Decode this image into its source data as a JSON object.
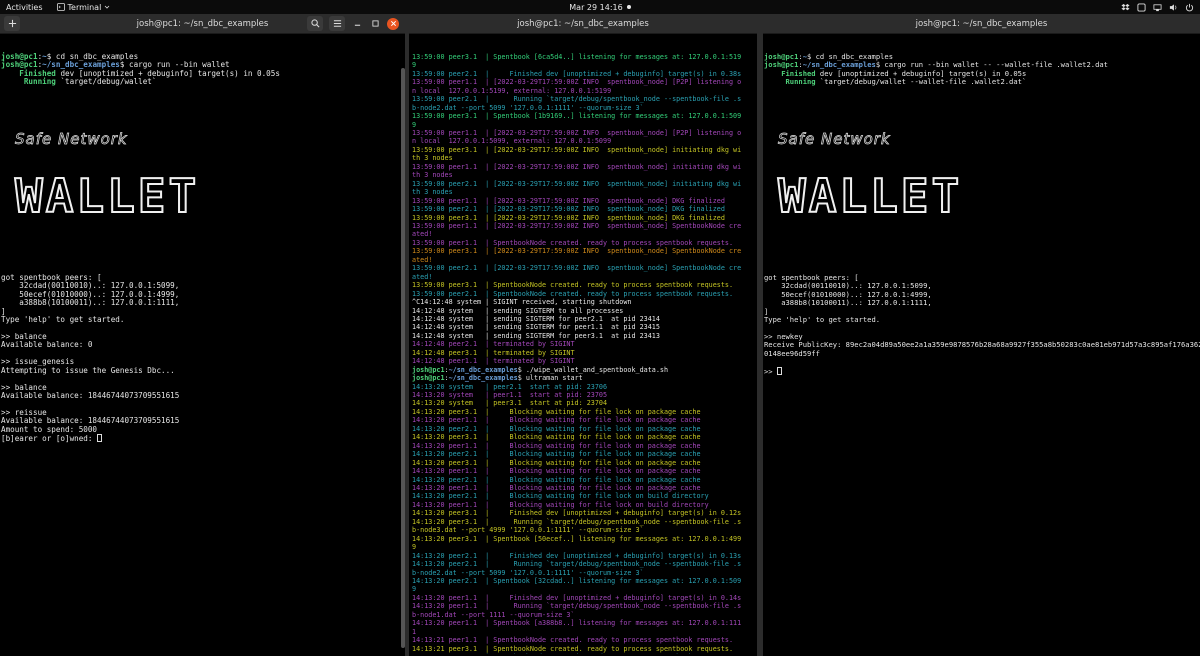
{
  "topbar": {
    "activities": "Activities",
    "app_menu": "Terminal",
    "clock": "Mar 29  14:16"
  },
  "windows": [
    {
      "title": "josh@pc1: ~/sn_dbc_examples"
    },
    {
      "title": "josh@pc1: ~/sn_dbc_examples"
    },
    {
      "title": "josh@pc1: ~/sn_dbc_examples"
    }
  ],
  "logo": {
    "small": "Safe Network",
    "big": "WALLET"
  },
  "left": {
    "pre": [
      [
        [
          "gb",
          "josh@pc1"
        ],
        [
          "w",
          ":"
        ],
        [
          "b",
          "~"
        ],
        [
          "w",
          "$ cd sn_dbc_examples"
        ]
      ],
      [
        [
          "gb",
          "josh@pc1"
        ],
        [
          "w",
          ":"
        ],
        [
          "b",
          "~/sn_dbc_examples"
        ],
        [
          "w",
          "$ cargo run --bin wallet"
        ]
      ],
      [
        [
          "gb",
          "    Finished"
        ],
        [
          "w",
          " dev [unoptimized + debuginfo] target(s) in 0.05s"
        ]
      ],
      [
        [
          "gb",
          "     Running"
        ],
        [
          "w",
          " `target/debug/wallet`"
        ]
      ]
    ],
    "post": [
      [
        [
          "w",
          ""
        ]
      ],
      [
        [
          "w",
          "got spentbook peers: ["
        ]
      ],
      [
        [
          "w",
          "    32cdad(00110010)..: 127.0.0.1:5099,"
        ]
      ],
      [
        [
          "w",
          "    50ecef(01010000)..: 127.0.0.1:4999,"
        ]
      ],
      [
        [
          "w",
          "    a388b8(10100011)..: 127.0.0.1:1111,"
        ]
      ],
      [
        [
          "w",
          "]"
        ]
      ],
      [
        [
          "w",
          "Type 'help' to get started."
        ]
      ],
      [
        [
          "w",
          ""
        ]
      ],
      [
        [
          "w",
          ">> balance"
        ]
      ],
      [
        [
          "w",
          "Available balance: 0"
        ]
      ],
      [
        [
          "w",
          ""
        ]
      ],
      [
        [
          "w",
          ">> issue_genesis"
        ]
      ],
      [
        [
          "w",
          "Attempting to issue the Genesis Dbc..."
        ]
      ],
      [
        [
          "w",
          ""
        ]
      ],
      [
        [
          "w",
          ">> balance"
        ]
      ],
      [
        [
          "w",
          "Available balance: 18446744073709551615"
        ]
      ],
      [
        [
          "w",
          ""
        ]
      ],
      [
        [
          "w",
          ">> reissue"
        ]
      ],
      [
        [
          "w",
          "Available balance: 18446744073709551615"
        ]
      ],
      [
        [
          "w",
          "Amount to spend: 5000"
        ]
      ],
      [
        [
          "w",
          "[b]earer or [o]wned: "
        ],
        [
          "cursor",
          ""
        ]
      ]
    ]
  },
  "middle": {
    "lines": [
      [
        [
          "pg",
          "13:59:00 peer3.1  | Spentbook [6ca5d4..] listening for messages at: 127.0.0.1:519"
        ]
      ],
      [
        [
          "pg",
          "9"
        ]
      ],
      [
        [
          "pc",
          "13:59:00 peer2.1  |     Finished dev [unoptimized + debuginfo] target(s) in 0.38s"
        ]
      ],
      [
        [
          "pp",
          "13:59:00 peer1.1  | [2022-03-29T17:59:00Z INFO  spentbook_node] [P2P] listening o"
        ]
      ],
      [
        [
          "pp",
          "n local  127.0.0.1:5199, external: 127.0.0.1:5199"
        ]
      ],
      [
        [
          "pc",
          "13:59:00 peer2.1  |      Running `target/debug/spentbook_node --spentbook-file .s"
        ]
      ],
      [
        [
          "pc",
          "b-node2.dat --port 5099 '127.0.0.1:1111' --quorum-size 3`"
        ]
      ],
      [
        [
          "pg",
          "13:59:00 peer3.1  | Spentbook [1b9169..] listening for messages at: 127.0.0.1:509"
        ]
      ],
      [
        [
          "pg",
          "9"
        ]
      ],
      [
        [
          "pp",
          "13:59:00 peer1.1  | [2022-03-29T17:59:00Z INFO  spentbook_node] [P2P] listening o"
        ]
      ],
      [
        [
          "pp",
          "n local  127.0.0.1:5099, external: 127.0.0.1:5099"
        ]
      ],
      [
        [
          "pt",
          "13:59:00 peer3.1  | [2022-03-29T17:59:00Z INFO  spentbook_node] initiating dkg wi"
        ]
      ],
      [
        [
          "pt",
          "th 3 nodes"
        ]
      ],
      [
        [
          "pp",
          "13:59:00 peer1.1  | [2022-03-29T17:59:00Z INFO  spentbook_node] initiating dkg wi"
        ]
      ],
      [
        [
          "pp",
          "th 3 nodes"
        ]
      ],
      [
        [
          "pc",
          "13:59:00 peer2.1  | [2022-03-29T17:59:00Z INFO  spentbook_node] initiating dkg wi"
        ]
      ],
      [
        [
          "pc",
          "th 3 nodes"
        ]
      ],
      [
        [
          "pp",
          "13:59:00 peer1.1  | [2022-03-29T17:59:00Z INFO  spentbook_node] DKG finalized"
        ]
      ],
      [
        [
          "pc",
          "13:59:00 peer2.1  | [2022-03-29T17:59:00Z INFO  spentbook_node] DKG finalized"
        ]
      ],
      [
        [
          "pt",
          "13:59:00 peer3.1  | [2022-03-29T17:59:00Z INFO  spentbook_node] DKG finalized"
        ]
      ],
      [
        [
          "pp",
          "13:59:00 peer1.1  | [2022-03-29T17:59:00Z INFO  spentbook_node] SpentbookNode cre"
        ]
      ],
      [
        [
          "pp",
          "ated!"
        ]
      ],
      [
        [
          "pp",
          "13:59:00 peer1.1  | SpentbookNode created. ready to process spentbook requests."
        ]
      ],
      [
        [
          "po",
          "13:59:00 peer3.1  | [2022-03-29T17:59:00Z INFO  spentbook_node] SpentbookNode cre"
        ]
      ],
      [
        [
          "po",
          "ated!"
        ]
      ],
      [
        [
          "pc",
          "13:59:00 peer2.1  | [2022-03-29T17:59:00Z INFO  spentbook_node] SpentbookNode cre"
        ]
      ],
      [
        [
          "pc",
          "ated!"
        ]
      ],
      [
        [
          "pt",
          "13:59:00 peer3.1  | SpentbookNode created. ready to process spentbook requests."
        ]
      ],
      [
        [
          "pc",
          "13:59:00 peer2.1  | SpentbookNode created. ready to process spentbook requests."
        ]
      ],
      [
        [
          "w",
          "^C14:12:48 system | SIGINT received, starting shutdown"
        ]
      ],
      [
        [
          "w",
          "14:12:48 system   | sending SIGTERM to all processes"
        ]
      ],
      [
        [
          "w",
          "14:12:48 system   | sending SIGTERM for peer2.1  at pid 23414"
        ]
      ],
      [
        [
          "w",
          "14:12:48 system   | sending SIGTERM for peer1.1  at pid 23415"
        ]
      ],
      [
        [
          "w",
          "14:12:48 system   | sending SIGTERM for peer3.1  at pid 23413"
        ]
      ],
      [
        [
          "pp",
          "14:12:48 peer2.1  | terminated by SIGINT"
        ]
      ],
      [
        [
          "pt",
          "14:12:48 peer3.1  | terminated by SIGINT"
        ]
      ],
      [
        [
          "pp",
          "14:12:48 peer1.1  | terminated by SIGINT"
        ]
      ],
      [
        [
          "gb",
          "josh@pc1"
        ],
        [
          "w",
          ":"
        ],
        [
          "b",
          "~/sn_dbc_examples"
        ],
        [
          "w",
          "$ ./wipe_wallet_and_spentbook_data.sh"
        ]
      ],
      [
        [
          "gb",
          "josh@pc1"
        ],
        [
          "w",
          ":"
        ],
        [
          "b",
          "~/sn_dbc_examples"
        ],
        [
          "w",
          "$ ultraman start"
        ]
      ],
      [
        [
          "pc",
          "14:13:20 system   | peer2.1  start at pid: 23706"
        ]
      ],
      [
        [
          "pp",
          "14:13:20 system   | peer1.1  start at pid: 23705"
        ]
      ],
      [
        [
          "pt",
          "14:13:20 system   | peer3.1  start at pid: 23704"
        ]
      ],
      [
        [
          "pt",
          "14:13:20 peer3.1  |     Blocking waiting for file lock on package cache"
        ]
      ],
      [
        [
          "pp",
          "14:13:20 peer1.1  |     Blocking waiting for file lock on package cache"
        ]
      ],
      [
        [
          "pc",
          "14:13:20 peer2.1  |     Blocking waiting for file lock on package cache"
        ]
      ],
      [
        [
          "pt",
          "14:13:20 peer3.1  |     Blocking waiting for file lock on package cache"
        ]
      ],
      [
        [
          "pp",
          "14:13:20 peer1.1  |     Blocking waiting for file lock on package cache"
        ]
      ],
      [
        [
          "pc",
          "14:13:20 peer2.1  |     Blocking waiting for file lock on package cache"
        ]
      ],
      [
        [
          "pt",
          "14:13:20 peer3.1  |     Blocking waiting for file lock on package cache"
        ]
      ],
      [
        [
          "pp",
          "14:13:20 peer1.1  |     Blocking waiting for file lock on package cache"
        ]
      ],
      [
        [
          "pc",
          "14:13:20 peer2.1  |     Blocking waiting for file lock on package cache"
        ]
      ],
      [
        [
          "pp",
          "14:13:20 peer1.1  |     Blocking waiting for file lock on package cache"
        ]
      ],
      [
        [
          "pc",
          "14:13:20 peer2.1  |     Blocking waiting for file lock on build directory"
        ]
      ],
      [
        [
          "pp",
          "14:13:20 peer1.1  |     Blocking waiting for file lock on build directory"
        ]
      ],
      [
        [
          "pt",
          "14:13:20 peer3.1  |     Finished dev [unoptimized + debuginfo] target(s) in 0.12s"
        ]
      ],
      [
        [
          "pt",
          "14:13:20 peer3.1  |      Running `target/debug/spentbook_node --spentbook-file .s"
        ]
      ],
      [
        [
          "pt",
          "b-node3.dat --port 4999 '127.0.0.1:1111' --quorum-size 3`"
        ]
      ],
      [
        [
          "pt",
          "14:13:20 peer3.1  | Spentbook [50ecef..] listening for messages at: 127.0.0.1:499"
        ]
      ],
      [
        [
          "pt",
          "9"
        ]
      ],
      [
        [
          "pc",
          "14:13:20 peer2.1  |     Finished dev [unoptimized + debuginfo] target(s) in 0.13s"
        ]
      ],
      [
        [
          "pc",
          "14:13:20 peer2.1  |      Running `target/debug/spentbook_node --spentbook-file .s"
        ]
      ],
      [
        [
          "pc",
          "b-node2.dat --port 5099 '127.0.0.1:1111' --quorum-size 3`"
        ]
      ],
      [
        [
          "pc",
          "14:13:20 peer2.1  | Spentbook [32cdad..] listening for messages at: 127.0.0.1:509"
        ]
      ],
      [
        [
          "pc",
          "9"
        ]
      ],
      [
        [
          "pp",
          "14:13:20 peer1.1  |     Finished dev [unoptimized + debuginfo] target(s) in 0.14s"
        ]
      ],
      [
        [
          "pp",
          "14:13:20 peer1.1  |      Running `target/debug/spentbook_node --spentbook-file .s"
        ]
      ],
      [
        [
          "pp",
          "b-node1.dat --port 1111 --quorum-size 3`"
        ]
      ],
      [
        [
          "pp",
          "14:13:20 peer1.1  | Spentbook [a388b8..] listening for messages at: 127.0.0.1:111"
        ]
      ],
      [
        [
          "pp",
          "1"
        ]
      ],
      [
        [
          "pp",
          "14:13:21 peer1.1  | SpentbookNode created. ready to process spentbook requests."
        ]
      ],
      [
        [
          "pt",
          "14:13:21 peer3.1  | SpentbookNode created. ready to process spentbook requests."
        ]
      ],
      [
        [
          "pc",
          "14:13:21 peer2.1  | SpentbookNode created. ready to process spentbook requests."
        ]
      ],
      [
        [
          "cursor",
          ""
        ]
      ]
    ]
  },
  "right": {
    "pre": [
      [
        [
          "gb",
          "josh@pc1"
        ],
        [
          "w",
          ":"
        ],
        [
          "b",
          "~"
        ],
        [
          "w",
          "$ cd sn_dbc_examples"
        ]
      ],
      [
        [
          "gb",
          "josh@pc1"
        ],
        [
          "w",
          ":"
        ],
        [
          "b",
          "~/sn_dbc_examples"
        ],
        [
          "w",
          "$ cargo run --bin wallet -- --wallet-file .wallet2.dat"
        ]
      ],
      [
        [
          "gb",
          "    Finished"
        ],
        [
          "w",
          " dev [unoptimized + debuginfo] target(s) in 0.05s"
        ]
      ],
      [
        [
          "gb",
          "     Running"
        ],
        [
          "w",
          " `target/debug/wallet --wallet-file .wallet2.dat`"
        ]
      ]
    ],
    "post": [
      [
        [
          "w",
          ""
        ]
      ],
      [
        [
          "w",
          "got spentbook peers: ["
        ]
      ],
      [
        [
          "w",
          "    32cdad(00110010)..: 127.0.0.1:5099,"
        ]
      ],
      [
        [
          "w",
          "    50ecef(01010000)..: 127.0.0.1:4999,"
        ]
      ],
      [
        [
          "w",
          "    a388b8(10100011)..: 127.0.0.1:1111,"
        ]
      ],
      [
        [
          "w",
          "]"
        ]
      ],
      [
        [
          "w",
          "Type 'help' to get started."
        ]
      ],
      [
        [
          "w",
          ""
        ]
      ],
      [
        [
          "w",
          ">> newkey"
        ]
      ],
      [
        [
          "w",
          "Receive PublicKey: 89ec2a04d89a50ee2a1a359e9878576b28a68a9927f355a8b50283c0ae81eb971d57a3c895af176a362"
        ]
      ],
      [
        [
          "w",
          "0148ee96d59ff"
        ]
      ],
      [
        [
          "w",
          ""
        ]
      ],
      [
        [
          "w",
          ">> "
        ],
        [
          "cursor",
          ""
        ]
      ]
    ]
  }
}
